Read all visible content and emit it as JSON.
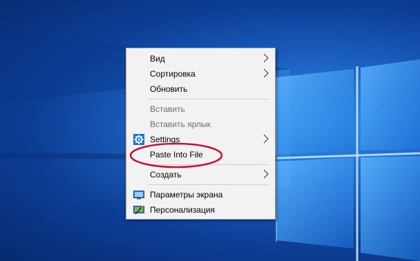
{
  "context_menu": {
    "items": [
      {
        "label": "Вид",
        "submenu": true,
        "enabled": true
      },
      {
        "label": "Сортировка",
        "submenu": true,
        "enabled": true
      },
      {
        "label": "Обновить",
        "submenu": false,
        "enabled": true
      },
      {
        "label": "Вставить",
        "submenu": false,
        "enabled": false
      },
      {
        "label": "Вставить ярлык",
        "submenu": false,
        "enabled": false
      },
      {
        "label": "Settings",
        "submenu": true,
        "enabled": true,
        "icon": "gear-icon"
      },
      {
        "label": "Paste Into File",
        "submenu": false,
        "enabled": true
      },
      {
        "label": "Создать",
        "submenu": true,
        "enabled": true
      },
      {
        "label": "Параметры экрана",
        "submenu": false,
        "enabled": true,
        "icon": "display-icon"
      },
      {
        "label": "Персонализация",
        "submenu": false,
        "enabled": true,
        "icon": "personalize-icon"
      }
    ]
  },
  "colors": {
    "menu_background": "#f2f2f2",
    "disabled_text": "#6d6d6d",
    "highlight_ring": "#c8102e",
    "wallpaper_blue": "#1c63c6"
  },
  "annotation": {
    "highlighted_item": "Paste Into File"
  }
}
